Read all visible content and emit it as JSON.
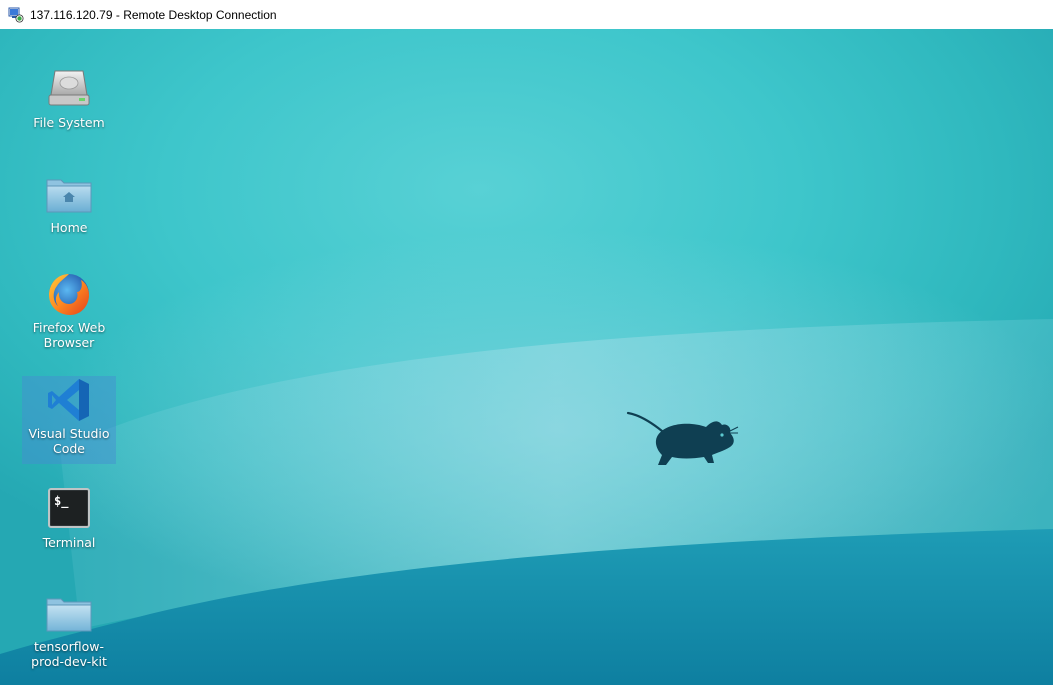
{
  "window": {
    "title": "137.116.120.79 - Remote Desktop Connection",
    "icon": "remote-desktop-icon"
  },
  "desktop": {
    "wallpaper": {
      "mascot": "xfce-mouse-icon",
      "colors": {
        "top": "#3ec6cb",
        "bottom": "#0e7fa0",
        "wave": "#1a93ad",
        "mascot": "#0f3f52"
      }
    },
    "icons": [
      {
        "label": "File System",
        "icon": "hard-drive-icon",
        "selected": false
      },
      {
        "label": "Home",
        "icon": "home-folder-icon",
        "selected": false
      },
      {
        "label": "Firefox Web\nBrowser",
        "icon": "firefox-icon",
        "selected": false
      },
      {
        "label": "Visual Studio\nCode",
        "icon": "vscode-icon",
        "selected": true
      },
      {
        "label": "Terminal",
        "icon": "terminal-icon",
        "selected": false
      },
      {
        "label": "tensorflow-\nprod-dev-kit",
        "icon": "folder-icon",
        "selected": false
      }
    ]
  }
}
